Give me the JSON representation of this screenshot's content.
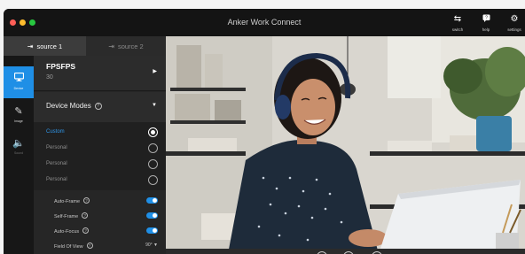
{
  "window": {
    "title": "Anker Work Connect",
    "toolbar": [
      {
        "id": "switch",
        "label": "switch",
        "icon": "swap-arrows-icon"
      },
      {
        "id": "help",
        "label": "help",
        "icon": "help-chat-icon"
      },
      {
        "id": "settings",
        "label": "settings",
        "icon": "gear-icon"
      }
    ]
  },
  "sources": {
    "tabs": [
      {
        "label": "source 1",
        "icon": "source-login-icon",
        "active": true
      },
      {
        "label": "source 2",
        "icon": "source-login-icon",
        "active": false
      }
    ]
  },
  "nav": {
    "items": [
      {
        "label": "Device",
        "icon": "monitor-icon",
        "active": true
      },
      {
        "label": "Image",
        "icon": "magic-wand-icon",
        "active": false
      },
      {
        "label": "Sound",
        "icon": "speaker-icon",
        "active": false
      }
    ]
  },
  "fps": {
    "title": "FPSFPS",
    "value": "30",
    "arrow": "▶"
  },
  "device_modes": {
    "title": "Device Modes",
    "help": "?",
    "arrow": "▼",
    "options": [
      {
        "label": "Custom",
        "selected": true
      },
      {
        "label": "Personal",
        "selected": false
      },
      {
        "label": "Personal",
        "selected": false
      },
      {
        "label": "Personal",
        "selected": false
      }
    ]
  },
  "toggles": {
    "auto_frame": {
      "label": "Auto-Frame",
      "on": true
    },
    "self_frame": {
      "label": "Self-Frame",
      "on": true
    },
    "auto_focus": {
      "label": "Auto-Focus",
      "on": true
    },
    "field_of_view": {
      "label": "Field Of View",
      "value": "90° ▼"
    }
  },
  "colors": {
    "accent": "#1f8fe6",
    "titlebar": "#141414",
    "panel": "#262626"
  }
}
